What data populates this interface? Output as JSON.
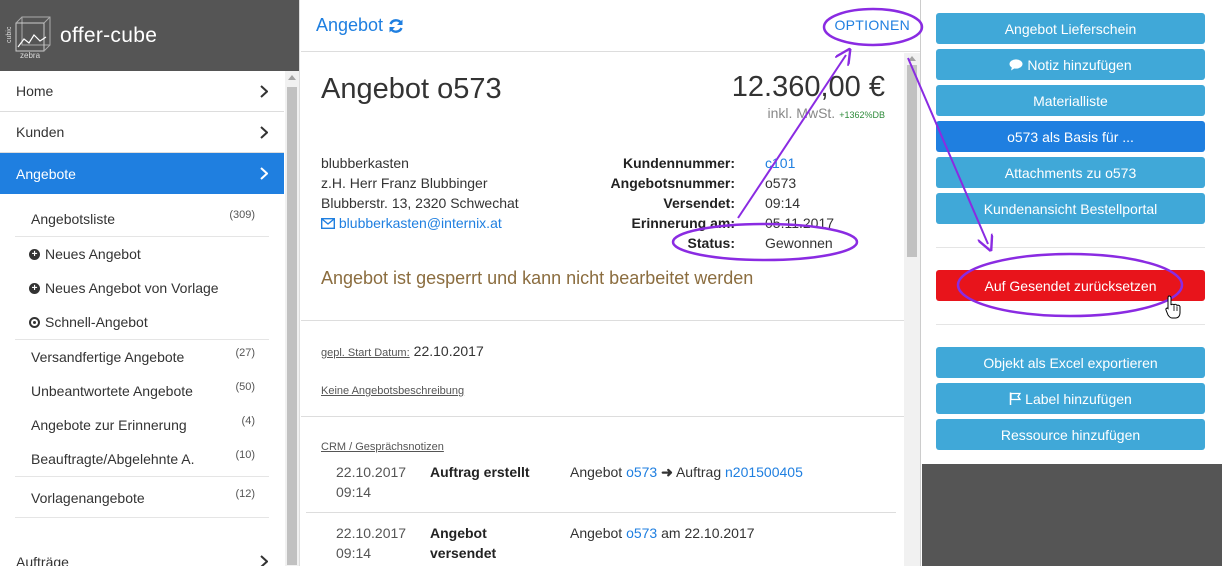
{
  "app": {
    "name": "offer-cube",
    "logo_small_left": "cubic",
    "logo_small_bottom": "zebra"
  },
  "sidebar": {
    "main_items": [
      {
        "label": "Home"
      },
      {
        "label": "Kunden"
      },
      {
        "label": "Angebote"
      }
    ],
    "sub_items": [
      {
        "label": "Angebotsliste",
        "count": "(309)"
      },
      {
        "label": "Neues Angebot"
      },
      {
        "label": "Neues Angebot von Vorlage"
      },
      {
        "label": "Schnell-Angebot"
      },
      {
        "label": "Versandfertige Angebote",
        "count": "(27)"
      },
      {
        "label": "Unbeantwortete Angebote",
        "count": "(50)"
      },
      {
        "label": "Angebote zur Erinnerung",
        "count": "(4)"
      },
      {
        "label": "Beauftragte/Abgelehnte A.",
        "count": "(10)"
      },
      {
        "label": "Vorlagenangebote",
        "count": "(12)"
      }
    ],
    "bottom_item": {
      "label": "Aufträge"
    }
  },
  "main": {
    "header_title": "Angebot",
    "options_label": "OPTIONEN",
    "offer_title": "Angebot o573",
    "amount": "12.360,00 €",
    "tax_note": "inkl. MwSt.",
    "db_note": "+1362%DB",
    "address": {
      "company": "blubberkasten",
      "contact": "z.H. Herr Franz Blubbinger",
      "street": "Blubberstr. 13, 2320 Schwechat",
      "email": "blubberkasten@internix.at"
    },
    "info": {
      "customer_no_label": "Kundennummer:",
      "customer_no": "c101",
      "offer_no_label": "Angebotsnummer:",
      "offer_no": "o573",
      "sent_label": "Versendet:",
      "sent": "09:14",
      "reminder_label": "Erinnerung am:",
      "reminder": "05.11.2017",
      "status_label": "Status:",
      "status": "Gewonnen"
    },
    "locked_message": "Angebot ist gesperrt und kann nicht bearbeitet werden",
    "start_date_label": "gepl. Start Datum:",
    "start_date": "22.10.2017",
    "no_description": "Keine Angebotsbeschreibung",
    "crm_title": "CRM / Gesprächsnotizen",
    "crm": [
      {
        "date": "22.10.2017",
        "time": "09:14",
        "event": "Auftrag erstellt",
        "text1": "Angebot",
        "link1": "o573",
        "text2": "Auftrag",
        "link2": "n201500405"
      },
      {
        "date": "22.10.2017",
        "time": "09:14",
        "event1": "Angebot",
        "event2": "versendet",
        "text1": "Angebot",
        "link1": "o573",
        "text2": "am 22.10.2017"
      }
    ]
  },
  "right_panel": {
    "buttons": [
      "Angebot Lieferschein",
      "Notiz hinzufügen",
      "Materialliste",
      "o573 als Basis für ...",
      "Attachments zu o573",
      "Kundenansicht Bestellportal",
      "Auf Gesendet zurücksetzen",
      "Objekt als Excel exportieren",
      "Label hinzufügen",
      "Ressource hinzufügen"
    ]
  },
  "colors": {
    "primary": "#1f7fe0",
    "info_button": "#40a8d8",
    "danger": "#e8141b",
    "annotation": "#8a2be2",
    "header_dark": "#555555"
  }
}
